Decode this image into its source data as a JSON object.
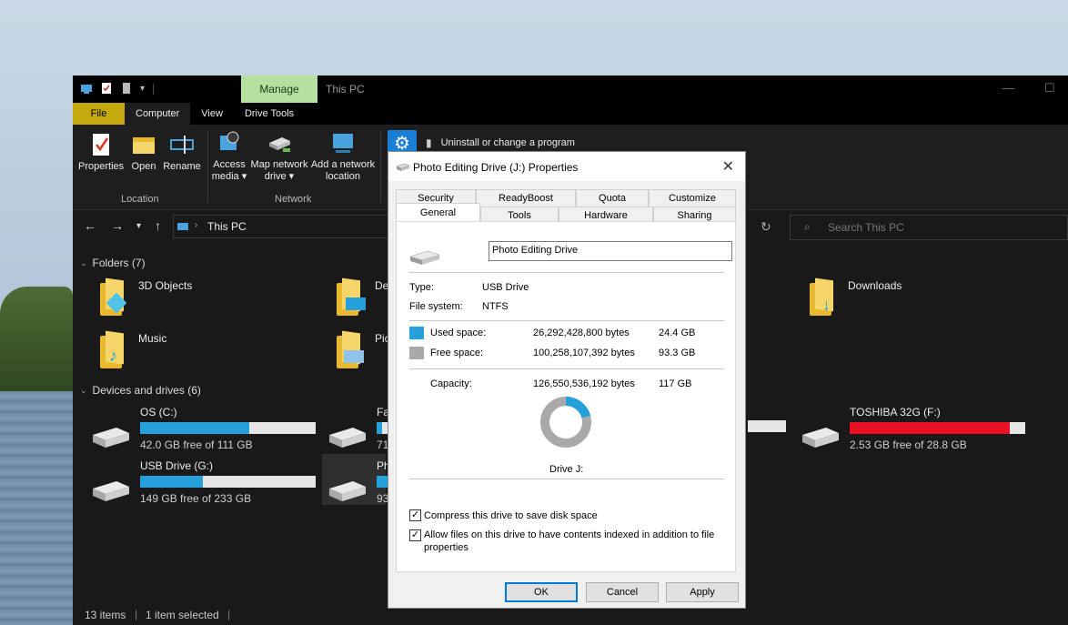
{
  "window": {
    "manage_tab": "Manage",
    "title": "This PC",
    "tabs": [
      "File",
      "Computer",
      "View",
      "Drive Tools"
    ],
    "active_tab": "Computer"
  },
  "ribbon": {
    "properties": "Properties",
    "open": "Open",
    "rename": "Rename",
    "access_media_1": "Access",
    "access_media_2": "media ▾",
    "map_drive_1": "Map network",
    "map_drive_2": "drive ▾",
    "add_location_1": "Add a network",
    "add_location_2": "location",
    "group_location": "Location",
    "group_network": "Network",
    "uninstall": "Uninstall or change a program"
  },
  "address": {
    "path": "This PC",
    "search_placeholder": "Search This PC"
  },
  "folders": {
    "header": "Folders (7)",
    "items": [
      "3D Objects",
      "De",
      "Downloads",
      "Music",
      "Pic"
    ]
  },
  "devices": {
    "header": "Devices and drives (6)",
    "items": [
      {
        "name": "OS (C:)",
        "free": "42.0 GB free of 111 GB",
        "used_fraction": 0.62
      },
      {
        "name": "Fas",
        "free": "71",
        "used_fraction": 0.1
      },
      {
        "name": "TOSHIBA 32G (F:)",
        "free": "2.53 GB free of 28.8 GB",
        "used_fraction": 0.91
      },
      {
        "name": "USB Drive (G:)",
        "free": "149 GB free of 233 GB",
        "used_fraction": 0.36
      },
      {
        "name": "Ph",
        "free": "93",
        "used_fraction": 0.2
      }
    ]
  },
  "status": {
    "items": "13 items",
    "selected": "1 item selected"
  },
  "dialog": {
    "title": "Photo Editing Drive (J:) Properties",
    "tabs_top": [
      "Security",
      "ReadyBoost",
      "Quota",
      "Customize"
    ],
    "tabs_bottom": [
      "General",
      "Tools",
      "Hardware",
      "Sharing"
    ],
    "active_tab": "General",
    "drive_name": "Photo Editing Drive",
    "type_label": "Type:",
    "type_value": "USB Drive",
    "fs_label": "File system:",
    "fs_value": "NTFS",
    "used_label": "Used space:",
    "used_bytes": "26,292,428,800 bytes",
    "used_gb": "24.4 GB",
    "free_label": "Free space:",
    "free_bytes": "100,258,107,392 bytes",
    "free_gb": "93.3 GB",
    "capacity_label": "Capacity:",
    "capacity_bytes": "126,550,536,192 bytes",
    "capacity_gb": "117 GB",
    "drive_label": "Drive J:",
    "used_fraction": 0.208,
    "compress_label": "Compress this drive to save disk space",
    "index_label_1": "Allow files on this drive to have contents indexed in addition to file",
    "index_label_2": "properties",
    "compress_checked": true,
    "index_checked": true,
    "ok": "OK",
    "cancel": "Cancel",
    "apply": "Apply",
    "colors": {
      "used": "#26a0da",
      "free": "#a9a9a9"
    }
  }
}
